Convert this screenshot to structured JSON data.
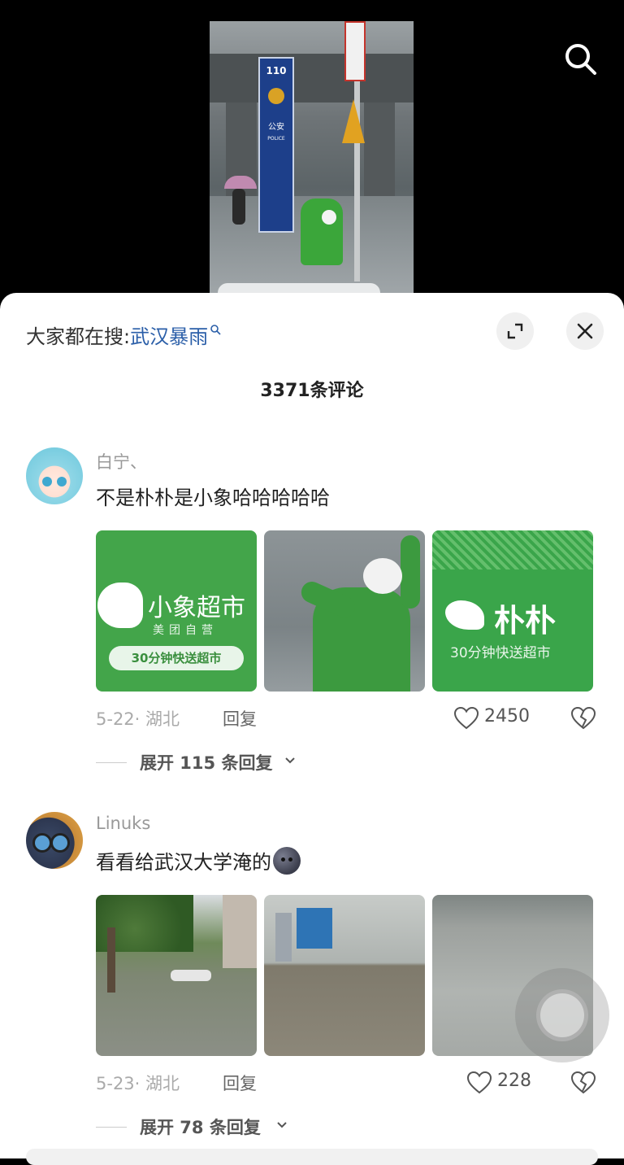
{
  "video": {
    "police_box_number": "110",
    "police_box_text": "公安",
    "police_box_subtext": "POLICE"
  },
  "sheet": {
    "trending_prefix": "大家都在搜:",
    "trending_term": "武汉暴雨",
    "comment_count": "3371条评论"
  },
  "comments": [
    {
      "username": "白宁、",
      "text": "不是朴朴是小象哈哈哈哈哈",
      "images": [
        {
          "title": "小象超市",
          "subtitle": "美团自营",
          "tag": "30分钟快送超市"
        },
        {
          "title": ""
        },
        {
          "title": "朴朴",
          "subtitle": "30分钟快送超市"
        }
      ],
      "date": "5-22· 湖北",
      "reply_label": "回复",
      "likes": "2450",
      "expand_replies": "展开 115 条回复"
    },
    {
      "username": "Linuks",
      "text": "看看给武汉大学淹的",
      "date": "5-23· 湖北",
      "reply_label": "回复",
      "likes": "228",
      "expand_replies": "展开 78 条回复"
    }
  ],
  "colors": {
    "link_blue": "#2a5ea8",
    "brand_green": "#43a54a",
    "sheet_bg": "#ffffff",
    "video_bg": "#000000"
  },
  "icons": [
    "search-icon",
    "expand-icon",
    "close-icon",
    "heart-icon",
    "dislike-heart-icon",
    "chevron-down-icon"
  ]
}
